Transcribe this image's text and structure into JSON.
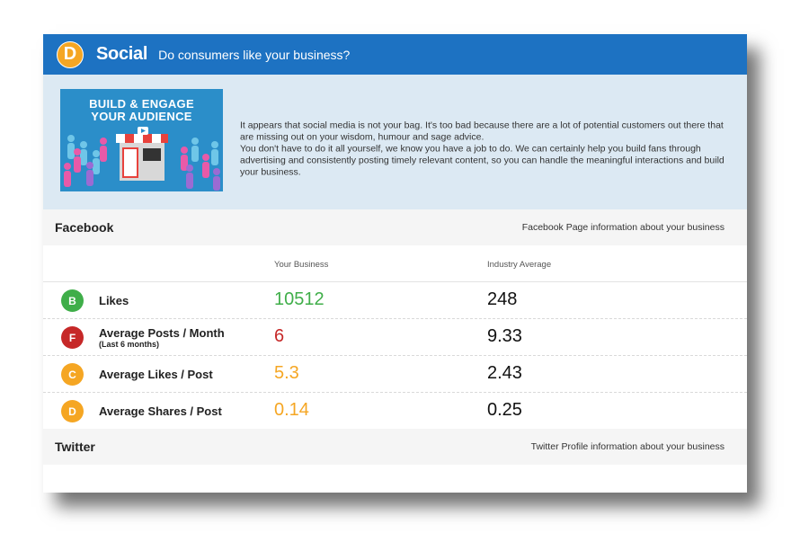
{
  "header": {
    "grade": "D",
    "title": "Social",
    "subtitle": "Do consumers like your business?"
  },
  "intro": {
    "promo_line1": "BUILD & ENGAGE",
    "promo_line2": "YOUR AUDIENCE",
    "paragraph1": "It appears that social media is not your bag. It's too bad because there are a lot of potential customers out there that are missing out on your wisdom, humour and sage advice.",
    "paragraph2": "You don't have to do it all yourself, we know you have a job to do. We can certainly help you build fans through advertising and consistently posting timely relevant content, so you can handle the meaningful interactions and build your business."
  },
  "facebook": {
    "title": "Facebook",
    "note": "Facebook Page information about your business",
    "col_your": "Your Business",
    "col_industry": "Industry Average",
    "rows": [
      {
        "grade": "B",
        "grade_color": "#3fae49",
        "name": "Likes",
        "sub": "",
        "your": "10512",
        "your_color": "#3fae49",
        "industry": "248"
      },
      {
        "grade": "F",
        "grade_color": "#c62828",
        "name": "Average Posts / Month",
        "sub": "(Last 6 months)",
        "your": "6",
        "your_color": "#c62828",
        "industry": "9.33"
      },
      {
        "grade": "C",
        "grade_color": "#f5a623",
        "name": "Average Likes / Post",
        "sub": "",
        "your": "5.3",
        "your_color": "#f5a623",
        "industry": "2.43"
      },
      {
        "grade": "D",
        "grade_color": "#f5a623",
        "name": "Average Shares / Post",
        "sub": "",
        "your": "0.14",
        "your_color": "#f5a623",
        "industry": "0.25"
      }
    ]
  },
  "twitter": {
    "title": "Twitter",
    "note": "Twitter Profile information about your business"
  },
  "colors": {
    "header_blue": "#1d72c2",
    "intro_bg": "#dce9f3",
    "grade_d_orange": "#f5a623"
  }
}
